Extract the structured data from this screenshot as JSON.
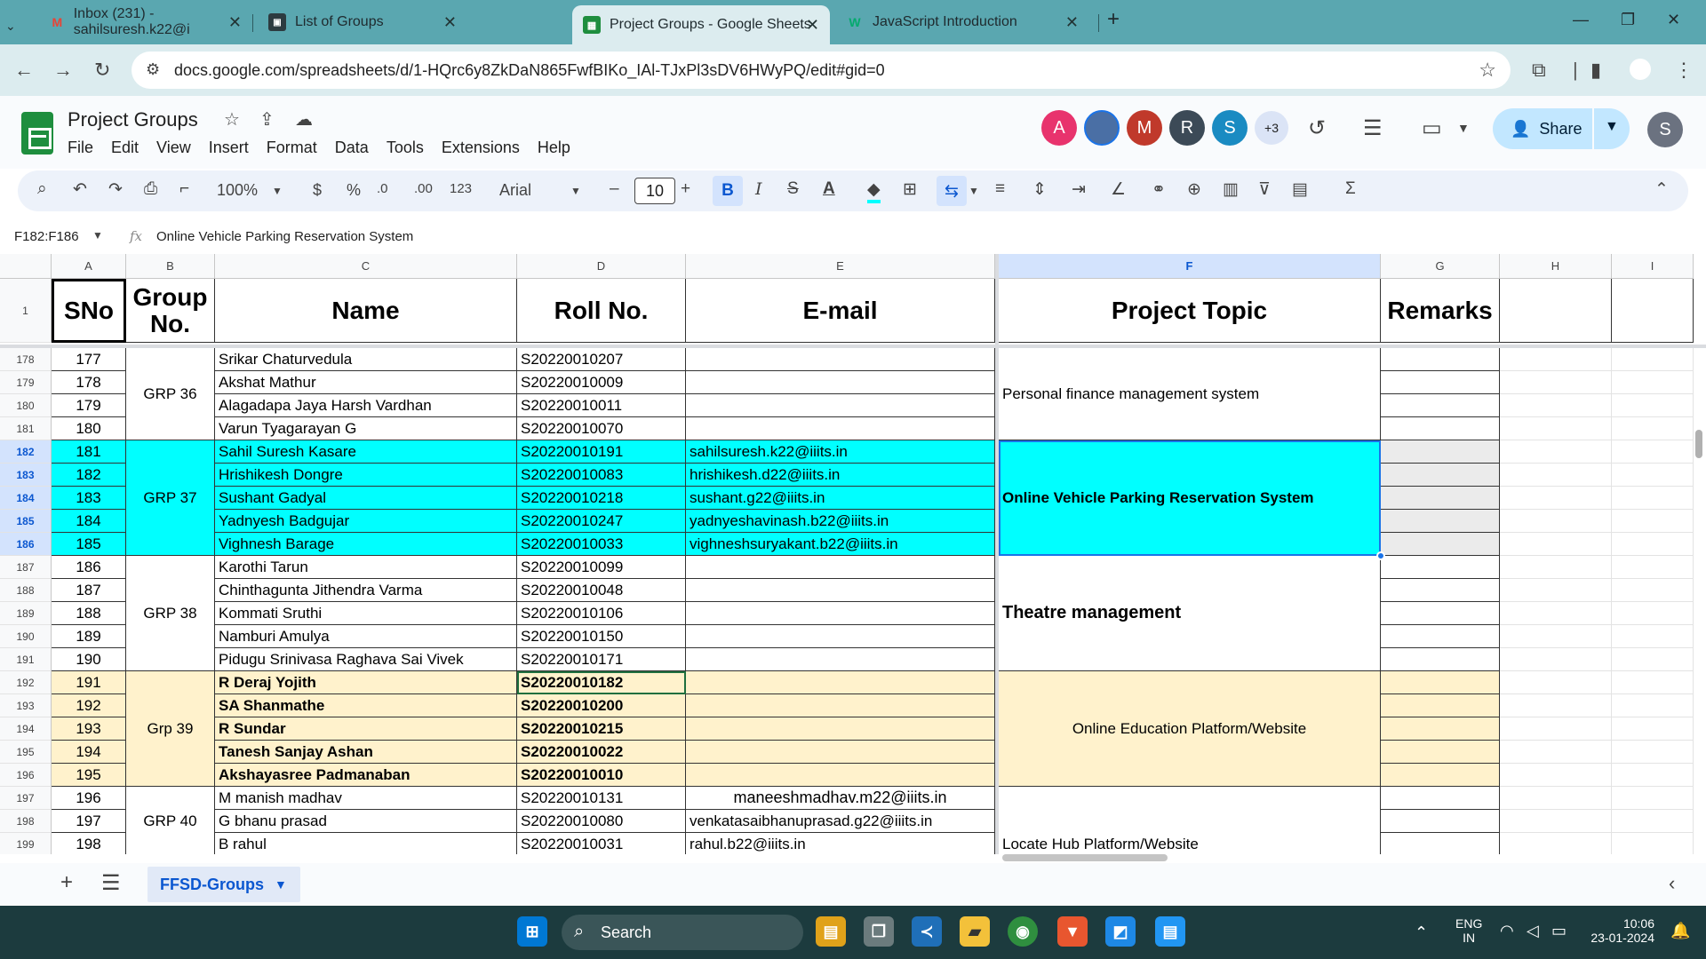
{
  "browser": {
    "tabs": [
      {
        "title": "Inbox (231) - sahilsuresh.k22@i",
        "icon": "gmail-icon"
      },
      {
        "title": "List of Groups",
        "icon": "doc-icon"
      },
      {
        "title": "Project Groups - Google Sheets",
        "icon": "sheets-icon"
      },
      {
        "title": "JavaScript Introduction",
        "icon": "w3schools-icon"
      }
    ],
    "url": "docs.google.com/spreadsheets/d/1-HQrc6y8ZkDaN865FwfBIKo_IAl-TJxPl3sDV6HWyPQ/edit#gid=0"
  },
  "sheets": {
    "title": "Project Groups",
    "menu": [
      "File",
      "Edit",
      "View",
      "Insert",
      "Format",
      "Data",
      "Tools",
      "Extensions",
      "Help"
    ],
    "collaborators": [
      {
        "initial": "A",
        "color": "#e8336d"
      },
      {
        "initial": "",
        "color": "#4a6fa5"
      },
      {
        "initial": "M",
        "color": "#c0392b"
      },
      {
        "initial": "R",
        "color": "#3c4a57"
      },
      {
        "initial": "S",
        "color": "#1a8bc2"
      }
    ],
    "more_collaborators": "+3",
    "share_label": "Share",
    "account_initial": "S"
  },
  "toolbar": {
    "zoom": "100%",
    "currency": "$",
    "percent": "%",
    "dec_decrease": ".0",
    "dec_increase": ".00",
    "format_123": "123",
    "font": "Arial",
    "font_size": "10"
  },
  "formula_bar": {
    "name_box": "F182:F186",
    "fx": "fx",
    "value": "Online Vehicle Parking Reservation System"
  },
  "grid": {
    "columns": [
      "A",
      "B",
      "C",
      "D",
      "E",
      "F",
      "G",
      "H",
      "I"
    ],
    "header": {
      "sno": "SNo",
      "group": "Group No.",
      "name": "Name",
      "roll": "Roll No.",
      "email": "E-mail",
      "topic": "Project Topic",
      "remarks": "Remarks"
    },
    "row_numbers": [
      "1",
      "178",
      "179",
      "180",
      "181",
      "182",
      "183",
      "184",
      "185",
      "186",
      "187",
      "188",
      "189",
      "190",
      "191",
      "192",
      "193",
      "194",
      "195",
      "196",
      "197",
      "198",
      "199"
    ],
    "rows": [
      {
        "sno": "177",
        "name": "Srikar Chaturvedula",
        "roll": "S20220010207",
        "email": ""
      },
      {
        "sno": "178",
        "name": "Akshat Mathur",
        "roll": "S20220010009",
        "email": ""
      },
      {
        "sno": "179",
        "name": "Alagadapa Jaya Harsh Vardhan",
        "roll": "S20220010011",
        "email": ""
      },
      {
        "sno": "180",
        "name": "Varun Tyagarayan G",
        "roll": "S20220010070",
        "email": ""
      },
      {
        "sno": "181",
        "name": "Sahil Suresh Kasare",
        "roll": "S20220010191",
        "email": "sahilsuresh.k22@iiits.in"
      },
      {
        "sno": "182",
        "name": "Hrishikesh Dongre",
        "roll": "S20220010083",
        "email": "hrishikesh.d22@iiits.in"
      },
      {
        "sno": "183",
        "name": "Sushant Gadyal",
        "roll": "S20220010218",
        "email": "sushant.g22@iiits.in"
      },
      {
        "sno": "184",
        "name": "Yadnyesh Badgujar",
        "roll": "S20220010247",
        "email": "yadnyeshavinash.b22@iiits.in"
      },
      {
        "sno": "185",
        "name": "Vighnesh Barage",
        "roll": "S20220010033",
        "email": "vighneshsuryakant.b22@iiits.in"
      },
      {
        "sno": "186",
        "name": "Karothi Tarun",
        "roll": "S20220010099",
        "email": ""
      },
      {
        "sno": "187",
        "name": "Chinthagunta Jithendra Varma",
        "roll": "S20220010048",
        "email": ""
      },
      {
        "sno": "188",
        "name": "Kommati Sruthi",
        "roll": "S20220010106",
        "email": ""
      },
      {
        "sno": "189",
        "name": "Namburi Amulya",
        "roll": "S20220010150",
        "email": ""
      },
      {
        "sno": "190",
        "name": "Pidugu Srinivasa Raghava Sai Vivek",
        "roll": "S20220010171",
        "email": ""
      },
      {
        "sno": "191",
        "name": "R Deraj Yojith",
        "roll": "S20220010182",
        "email": ""
      },
      {
        "sno": "192",
        "name": "SA Shanmathe",
        "roll": "S20220010200",
        "email": ""
      },
      {
        "sno": "193",
        "name": "R Sundar",
        "roll": "S20220010215",
        "email": ""
      },
      {
        "sno": "194",
        "name": "Tanesh Sanjay Ashan",
        "roll": "S20220010022",
        "email": ""
      },
      {
        "sno": "195",
        "name": "Akshayasree Padmanaban",
        "roll": "S20220010010",
        "email": ""
      },
      {
        "sno": "196",
        "name": " M manish madhav",
        "roll": "S20220010131",
        "email": "maneeshmadhav.m22@iiits.in"
      },
      {
        "sno": "197",
        "name": "G bhanu prasad",
        "roll": "S20220010080",
        "email": "venkatasaibhanuprasad.g22@iiits.in"
      },
      {
        "sno": "198",
        "name": " B rahul",
        "roll": "S20220010031",
        "email": "rahul.b22@iiits.in"
      }
    ],
    "groups": [
      {
        "label": "GRP 36",
        "topic": "Personal finance management system"
      },
      {
        "label": "GRP 37",
        "topic": "Online Vehicle Parking Reservation System"
      },
      {
        "label": "GRP 38",
        "topic": "Theatre management"
      },
      {
        "label": "Grp 39",
        "topic": "Online Education Platform/Website"
      },
      {
        "label": "GRP 40",
        "topic": "Locate Hub Platform/Website"
      }
    ],
    "colors": {
      "selected": "#00ffff",
      "cream": "#fff2cc"
    }
  },
  "sheet_tabs": {
    "active": "FFSD-Groups"
  },
  "taskbar": {
    "search": "Search",
    "lang_top": "ENG",
    "lang_bottom": "IN",
    "time": "10:06",
    "date": "23-01-2024"
  }
}
